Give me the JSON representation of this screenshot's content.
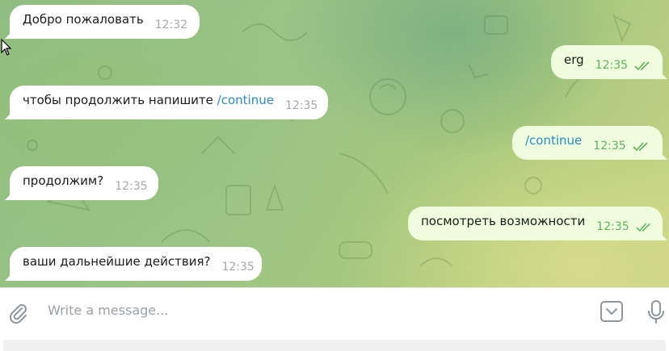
{
  "messages": [
    {
      "direction": "in",
      "text": "Добро пожаловать",
      "time": "12:32"
    },
    {
      "direction": "in",
      "text": "чтобы продолжить напишите ",
      "link": "/continue",
      "time": "12:35"
    },
    {
      "direction": "in",
      "text": "продолжим?",
      "time": "12:35"
    },
    {
      "direction": "in",
      "text": "ваши дальнейшие действия?",
      "time": "12:35"
    },
    {
      "direction": "out",
      "text": "erg",
      "time": "12:35",
      "status": "read"
    },
    {
      "direction": "out",
      "link": "/continue",
      "time": "12:35",
      "status": "read"
    },
    {
      "direction": "out",
      "text": "посмотреть возможности",
      "time": "12:35",
      "status": "read"
    }
  ],
  "composer": {
    "placeholder": "Write a message...",
    "attach_icon": "paperclip-icon",
    "emoji_icon": "chevron-down-icon",
    "voice_icon": "microphone-icon"
  },
  "colors": {
    "incoming_bubble": "#ffffff",
    "outgoing_bubble": "#effdde",
    "link": "#2a8bc7",
    "outgoing_time": "#5fb25c",
    "incoming_time": "#a3a9ae"
  }
}
